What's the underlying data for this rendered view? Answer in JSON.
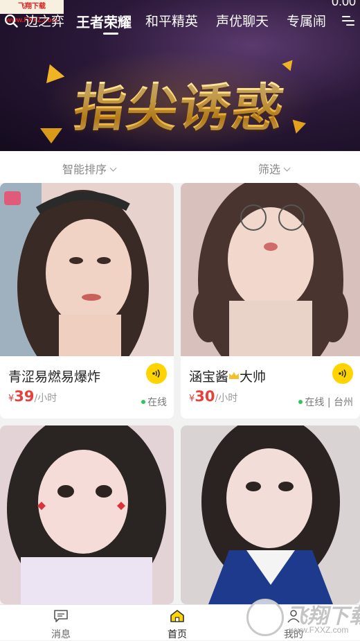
{
  "status_bar": {
    "time": "0:00"
  },
  "watermark_top": "飞翔下载 www.FXXZ.com",
  "nav": {
    "tabs": [
      {
        "label": "边之弈",
        "active": false
      },
      {
        "label": "王者荣耀",
        "active": true
      },
      {
        "label": "和平精英",
        "active": false
      },
      {
        "label": "声优聊天",
        "active": false
      },
      {
        "label": "专属闹",
        "active": false
      }
    ]
  },
  "banner": {
    "title": "指尖诱惑"
  },
  "filters": {
    "sort_label": "智能排序",
    "filter_label": "筛选"
  },
  "cards": [
    {
      "name": "青涩易燃易爆炸",
      "currency": "¥",
      "price": "39",
      "unit": "/小时",
      "status": "在线",
      "photo_tone": "#d9b9b4"
    },
    {
      "name_before": "涵宝酱",
      "name_after": "大帅",
      "currency": "¥",
      "price": "30",
      "unit": "/小时",
      "status": "在线 | 台州",
      "photo_tone": "#c9a9a8"
    },
    {
      "photo_tone": "#d8c2c7"
    },
    {
      "photo_tone": "#bfc7d8"
    }
  ],
  "tabbar": {
    "items": [
      {
        "label": "消息",
        "icon": "message-icon"
      },
      {
        "label": "首页",
        "icon": "home-icon"
      },
      {
        "label": "我的",
        "icon": "profile-icon"
      }
    ]
  },
  "watermark_bottom": {
    "brand": "飞翔下载",
    "url": "www.FXXZ.com"
  }
}
